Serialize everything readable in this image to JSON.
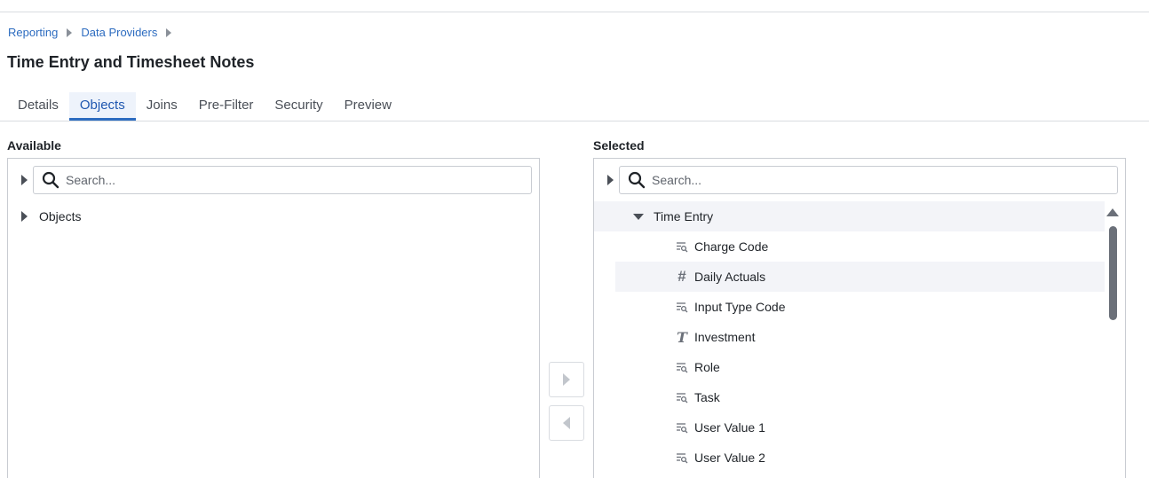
{
  "breadcrumb": {
    "items": [
      "Reporting",
      "Data Providers"
    ]
  },
  "page_title": "Time Entry and Timesheet Notes",
  "tabs": [
    {
      "label": "Details",
      "active": false
    },
    {
      "label": "Objects",
      "active": true
    },
    {
      "label": "Joins",
      "active": false
    },
    {
      "label": "Pre-Filter",
      "active": false
    },
    {
      "label": "Security",
      "active": false
    },
    {
      "label": "Preview",
      "active": false
    }
  ],
  "available": {
    "label": "Available",
    "search_placeholder": "Search...",
    "tree": [
      {
        "label": "Objects",
        "expanded": false
      }
    ]
  },
  "selected": {
    "label": "Selected",
    "search_placeholder": "Search...",
    "group": {
      "label": "Time Entry",
      "expanded": true
    },
    "fields": [
      {
        "label": "Charge Code",
        "icon": "lookup-icon",
        "highlighted": false
      },
      {
        "label": "Daily Actuals",
        "icon": "number-icon",
        "highlighted": true
      },
      {
        "label": "Input Type Code",
        "icon": "lookup-icon",
        "highlighted": false
      },
      {
        "label": "Investment",
        "icon": "text-icon",
        "highlighted": false
      },
      {
        "label": "Role",
        "icon": "lookup-icon",
        "highlighted": false
      },
      {
        "label": "Task",
        "icon": "lookup-icon",
        "highlighted": false
      },
      {
        "label": "User Value 1",
        "icon": "lookup-icon",
        "highlighted": false
      },
      {
        "label": "User Value 2",
        "icon": "lookup-icon",
        "highlighted": false
      }
    ]
  },
  "colors": {
    "accent": "#2d6cc0",
    "border": "#c9ccd2",
    "highlight_row": "#f3f4f8"
  }
}
